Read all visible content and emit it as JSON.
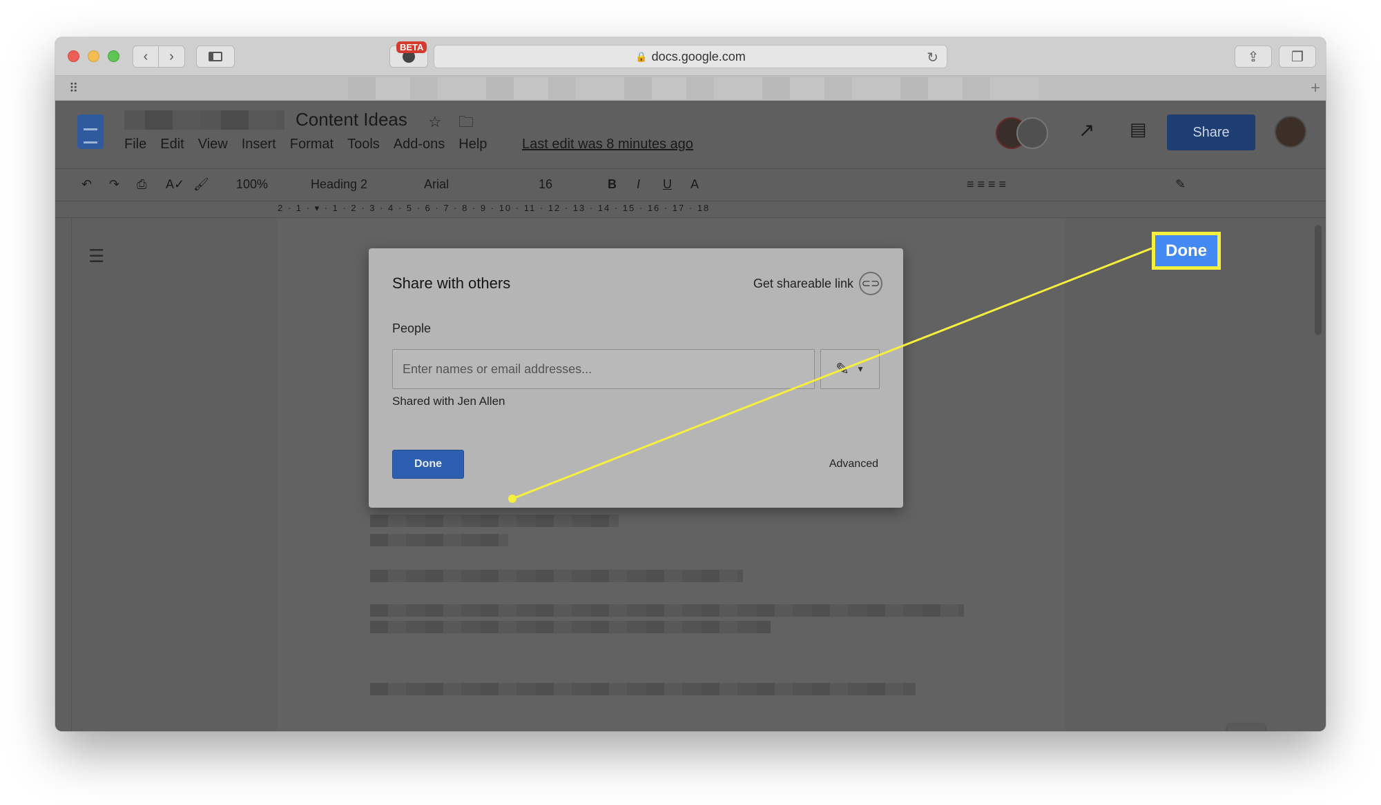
{
  "browser": {
    "url": "docs.google.com",
    "extension_badge": "BETA"
  },
  "docs": {
    "title": "Content Ideas",
    "menus": [
      "File",
      "Edit",
      "View",
      "Insert",
      "Format",
      "Tools",
      "Add-ons",
      "Help"
    ],
    "last_edit": "Last edit was 8 minutes ago",
    "share_label": "Share",
    "toolbar": {
      "zoom": "100%",
      "style": "Heading 2",
      "font": "Arial",
      "font_size": "16"
    },
    "ruler": "2 · 1 · ▾ · 1 · 2 · 3 · 4 · 5 · 6 · 7 · 8 · 9 · 10 · 11 · 12 · 13 · 14 · 15 · 16 · 17 · 18"
  },
  "dialog": {
    "title": "Share with others",
    "get_link": "Get shareable link",
    "people_label": "People",
    "input_placeholder": "Enter names or email addresses...",
    "shared_with": "Shared with Jen Allen",
    "done_label": "Done",
    "advanced_label": "Advanced"
  },
  "callout": {
    "label": "Done",
    "border_color": "#f6ef3e",
    "fill_color": "#4289f4"
  },
  "icons": {
    "lock": "🔒",
    "reload": "↻",
    "back": "‹",
    "forward": "›",
    "star": "☆",
    "folder": "🗀",
    "trend": "↗",
    "comment": "▤",
    "pencil": "✎",
    "link": "⊂⊃",
    "outline": "☰",
    "apps": "⠿",
    "plus": "+",
    "share": "⇪",
    "tabs": "❐"
  }
}
